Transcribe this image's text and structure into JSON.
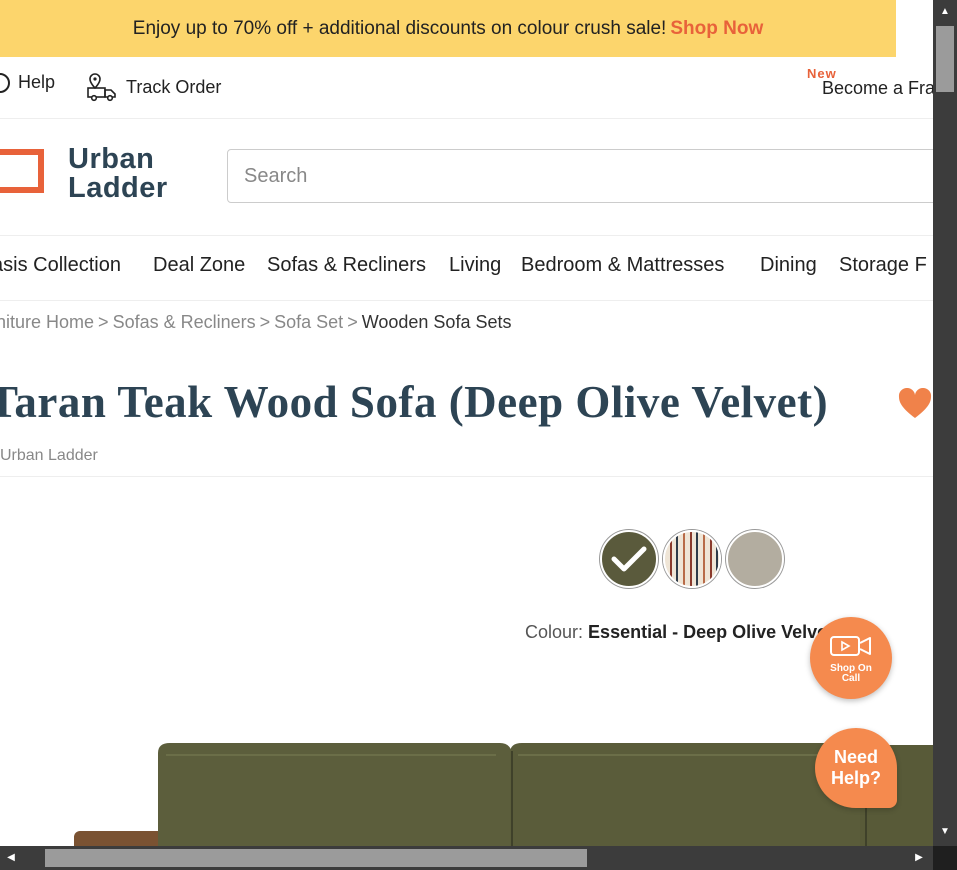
{
  "promo": {
    "text": "Enjoy up to 70% off + additional discounts on colour crush sale!",
    "link": "Shop Now"
  },
  "utility": {
    "help": "Help",
    "track_order": "Track Order",
    "new_badge": "New",
    "franchise": "Become a Fra"
  },
  "logo": {
    "line1": "Urban",
    "line2": "Ladder"
  },
  "search": {
    "placeholder": "Search"
  },
  "nav": {
    "items": [
      "asis Collection",
      "Deal Zone",
      "Sofas & Recliners",
      "Living",
      "Bedroom & Mattresses",
      "Dining",
      "Storage F"
    ]
  },
  "breadcrumb": {
    "items": [
      "rniture Home",
      "Sofas & Recliners",
      "Sofa Set"
    ],
    "current": "Wooden Sofa Sets",
    "separator": ">"
  },
  "product": {
    "title": "Taran Teak Wood Sofa (Deep Olive Velvet)",
    "brand": "Urban Ladder",
    "colour_label": "Colour:",
    "colour_value": "Essential - Deep Olive Velvet"
  },
  "swatches": [
    {
      "name": "Deep Olive Velvet",
      "color": "#5a5a3c",
      "selected": true
    },
    {
      "name": "Patterned",
      "color": "#efe5d6",
      "selected": false
    },
    {
      "name": "Grey",
      "color": "#b3ada0",
      "selected": false
    }
  ],
  "floating": {
    "shop_on_call_1": "Shop On",
    "shop_on_call_2": "Call",
    "need_help_1": "Need",
    "need_help_2": "Help?"
  },
  "colors": {
    "accent": "#e8623a",
    "banner": "#fcd56c",
    "brand_text": "#2d4454",
    "fab": "#f58a4e"
  }
}
